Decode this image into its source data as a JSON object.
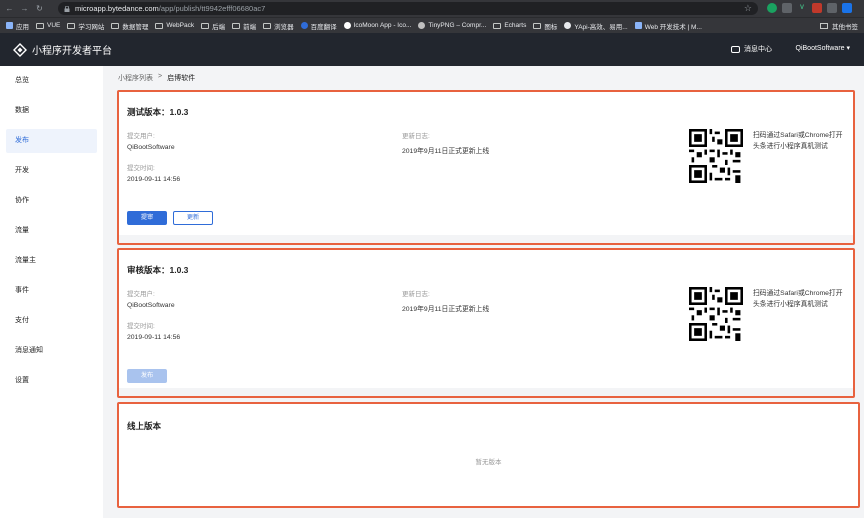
{
  "browser": {
    "url_host": "microapp.bytedance.com",
    "url_path": "/app/publish/tt9942efff06680ac7",
    "bookmarks": [
      {
        "label": "应用",
        "icon": "grid-icon"
      },
      {
        "label": "VUE",
        "icon": "folder-icon"
      },
      {
        "label": "学习网站",
        "icon": "folder-icon"
      },
      {
        "label": "数据管理",
        "icon": "folder-icon"
      },
      {
        "label": "WebPack",
        "icon": "folder-icon"
      },
      {
        "label": "后端",
        "icon": "folder-icon"
      },
      {
        "label": "前端",
        "icon": "folder-icon"
      },
      {
        "label": "浏览器",
        "icon": "folder-icon"
      },
      {
        "label": "百度翻译",
        "icon": "translate-icon"
      },
      {
        "label": "IcoMoon App - Ico...",
        "icon": "icomoon-icon"
      },
      {
        "label": "TinyPNG – Compr...",
        "icon": "panda-icon"
      },
      {
        "label": "Echarts",
        "icon": "folder-icon"
      },
      {
        "label": "图标",
        "icon": "folder-icon"
      },
      {
        "label": "YApi-高效、易用...",
        "icon": "yapi-icon"
      },
      {
        "label": "Web 开发技术 | M...",
        "icon": "mdn-icon"
      }
    ],
    "other_bookmarks": "其他书签"
  },
  "header": {
    "title": "小程序开发者平台",
    "message_center": "消息中心",
    "user": "QiBootSoftware ▾"
  },
  "sidebar": {
    "items": [
      {
        "label": "总览",
        "active": false
      },
      {
        "label": "数据",
        "active": false
      },
      {
        "label": "发布",
        "active": true
      },
      {
        "label": "开发",
        "active": false
      },
      {
        "label": "协作",
        "active": false
      },
      {
        "label": "流量",
        "active": false
      },
      {
        "label": "流量主",
        "active": false
      },
      {
        "label": "事件",
        "active": false
      },
      {
        "label": "支付",
        "active": false
      },
      {
        "label": "消息通知",
        "active": false
      },
      {
        "label": "设置",
        "active": false
      }
    ]
  },
  "breadcrumb": {
    "parent": "小程序列表",
    "separator": ">",
    "current": "启博软件"
  },
  "test_card": {
    "title": "测试版本：1.0.3",
    "submitter_label": "提交用户:",
    "submitter": "QiBootSoftware",
    "time_label": "提交时间:",
    "time": "2019-09-11 14:56",
    "log_label": "更新日志:",
    "log": "2019年9月11日正式更新上线",
    "qr_tip": "扫码通过Safari或Chrome打开头条进行小程序真机测试",
    "submit_button": "提审",
    "update_button": "更新"
  },
  "review_card": {
    "title": "审核版本：1.0.3",
    "submitter_label": "提交用户:",
    "submitter": "QiBootSoftware",
    "time_label": "提交时间:",
    "time": "2019-09-11 14:56",
    "log_label": "更新日志:",
    "log": "2019年9月11日正式更新上线",
    "qr_tip": "扫码通过Safari或Chrome打开头条进行小程序真机测试",
    "publish_button": "发布"
  },
  "online_card": {
    "title": "线上版本",
    "empty_text": "暂无版本"
  },
  "colors": {
    "accent": "#2f6cd8",
    "highlight_border": "#e8623f",
    "header_bg": "#22262e"
  }
}
